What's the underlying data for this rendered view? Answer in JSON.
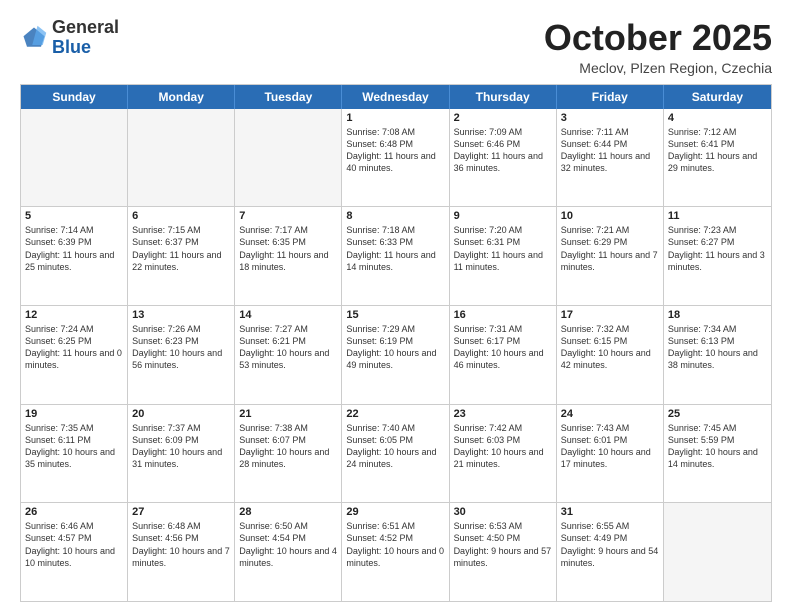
{
  "header": {
    "logo_general": "General",
    "logo_blue": "Blue",
    "month_title": "October 2025",
    "location": "Meclov, Plzen Region, Czechia"
  },
  "days_of_week": [
    "Sunday",
    "Monday",
    "Tuesday",
    "Wednesday",
    "Thursday",
    "Friday",
    "Saturday"
  ],
  "weeks": [
    [
      {
        "day": "",
        "text": ""
      },
      {
        "day": "",
        "text": ""
      },
      {
        "day": "",
        "text": ""
      },
      {
        "day": "1",
        "text": "Sunrise: 7:08 AM\nSunset: 6:48 PM\nDaylight: 11 hours and 40 minutes."
      },
      {
        "day": "2",
        "text": "Sunrise: 7:09 AM\nSunset: 6:46 PM\nDaylight: 11 hours and 36 minutes."
      },
      {
        "day": "3",
        "text": "Sunrise: 7:11 AM\nSunset: 6:44 PM\nDaylight: 11 hours and 32 minutes."
      },
      {
        "day": "4",
        "text": "Sunrise: 7:12 AM\nSunset: 6:41 PM\nDaylight: 11 hours and 29 minutes."
      }
    ],
    [
      {
        "day": "5",
        "text": "Sunrise: 7:14 AM\nSunset: 6:39 PM\nDaylight: 11 hours and 25 minutes."
      },
      {
        "day": "6",
        "text": "Sunrise: 7:15 AM\nSunset: 6:37 PM\nDaylight: 11 hours and 22 minutes."
      },
      {
        "day": "7",
        "text": "Sunrise: 7:17 AM\nSunset: 6:35 PM\nDaylight: 11 hours and 18 minutes."
      },
      {
        "day": "8",
        "text": "Sunrise: 7:18 AM\nSunset: 6:33 PM\nDaylight: 11 hours and 14 minutes."
      },
      {
        "day": "9",
        "text": "Sunrise: 7:20 AM\nSunset: 6:31 PM\nDaylight: 11 hours and 11 minutes."
      },
      {
        "day": "10",
        "text": "Sunrise: 7:21 AM\nSunset: 6:29 PM\nDaylight: 11 hours and 7 minutes."
      },
      {
        "day": "11",
        "text": "Sunrise: 7:23 AM\nSunset: 6:27 PM\nDaylight: 11 hours and 3 minutes."
      }
    ],
    [
      {
        "day": "12",
        "text": "Sunrise: 7:24 AM\nSunset: 6:25 PM\nDaylight: 11 hours and 0 minutes."
      },
      {
        "day": "13",
        "text": "Sunrise: 7:26 AM\nSunset: 6:23 PM\nDaylight: 10 hours and 56 minutes."
      },
      {
        "day": "14",
        "text": "Sunrise: 7:27 AM\nSunset: 6:21 PM\nDaylight: 10 hours and 53 minutes."
      },
      {
        "day": "15",
        "text": "Sunrise: 7:29 AM\nSunset: 6:19 PM\nDaylight: 10 hours and 49 minutes."
      },
      {
        "day": "16",
        "text": "Sunrise: 7:31 AM\nSunset: 6:17 PM\nDaylight: 10 hours and 46 minutes."
      },
      {
        "day": "17",
        "text": "Sunrise: 7:32 AM\nSunset: 6:15 PM\nDaylight: 10 hours and 42 minutes."
      },
      {
        "day": "18",
        "text": "Sunrise: 7:34 AM\nSunset: 6:13 PM\nDaylight: 10 hours and 38 minutes."
      }
    ],
    [
      {
        "day": "19",
        "text": "Sunrise: 7:35 AM\nSunset: 6:11 PM\nDaylight: 10 hours and 35 minutes."
      },
      {
        "day": "20",
        "text": "Sunrise: 7:37 AM\nSunset: 6:09 PM\nDaylight: 10 hours and 31 minutes."
      },
      {
        "day": "21",
        "text": "Sunrise: 7:38 AM\nSunset: 6:07 PM\nDaylight: 10 hours and 28 minutes."
      },
      {
        "day": "22",
        "text": "Sunrise: 7:40 AM\nSunset: 6:05 PM\nDaylight: 10 hours and 24 minutes."
      },
      {
        "day": "23",
        "text": "Sunrise: 7:42 AM\nSunset: 6:03 PM\nDaylight: 10 hours and 21 minutes."
      },
      {
        "day": "24",
        "text": "Sunrise: 7:43 AM\nSunset: 6:01 PM\nDaylight: 10 hours and 17 minutes."
      },
      {
        "day": "25",
        "text": "Sunrise: 7:45 AM\nSunset: 5:59 PM\nDaylight: 10 hours and 14 minutes."
      }
    ],
    [
      {
        "day": "26",
        "text": "Sunrise: 6:46 AM\nSunset: 4:57 PM\nDaylight: 10 hours and 10 minutes."
      },
      {
        "day": "27",
        "text": "Sunrise: 6:48 AM\nSunset: 4:56 PM\nDaylight: 10 hours and 7 minutes."
      },
      {
        "day": "28",
        "text": "Sunrise: 6:50 AM\nSunset: 4:54 PM\nDaylight: 10 hours and 4 minutes."
      },
      {
        "day": "29",
        "text": "Sunrise: 6:51 AM\nSunset: 4:52 PM\nDaylight: 10 hours and 0 minutes."
      },
      {
        "day": "30",
        "text": "Sunrise: 6:53 AM\nSunset: 4:50 PM\nDaylight: 9 hours and 57 minutes."
      },
      {
        "day": "31",
        "text": "Sunrise: 6:55 AM\nSunset: 4:49 PM\nDaylight: 9 hours and 54 minutes."
      },
      {
        "day": "",
        "text": ""
      }
    ]
  ]
}
